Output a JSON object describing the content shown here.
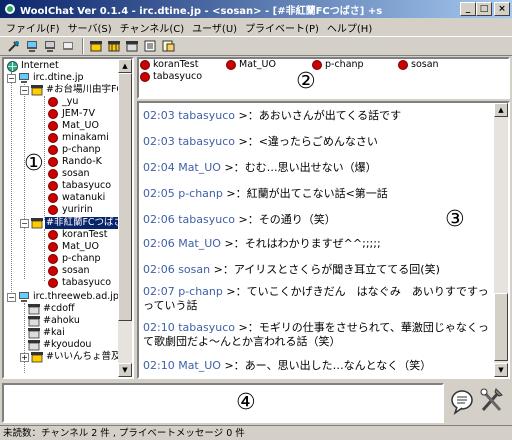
{
  "window": {
    "title": "WoolChat Ver 0.1.4 - irc.dtine.jp - <sosan> - [#非紅蘭FCつばさ] +s",
    "minimize": "_",
    "maximize": "□",
    "close": "×"
  },
  "menu": [
    "ファイル(F)",
    "サーバ(S)",
    "チャンネル(C)",
    "ユーザ(U)",
    "プライベート(P)",
    "ヘルプ(H)"
  ],
  "tree": {
    "root": "Internet",
    "servers": [
      {
        "name": "irc.dtine.jp",
        "channels": [
          {
            "name": "#お台場川由宇FC",
            "users": [
              "_yu",
              "JEM-7V",
              "Mat_UO",
              "minakami",
              "p-chanp",
              "Rando-K",
              "sosan",
              "tabasyuco",
              "watanuki",
              "yuririn"
            ]
          },
          {
            "name": "#非紅蘭FCつばさ",
            "users": [
              "koranTest",
              "Mat_UO",
              "p-chanp",
              "sosan",
              "tabasyuco"
            ]
          }
        ]
      },
      {
        "name": "irc.threeweb.ad.jp",
        "channels": [
          {
            "name": "#cdoff"
          },
          {
            "name": "#ahoku"
          },
          {
            "name": "#kai"
          },
          {
            "name": "#kyoudou"
          },
          {
            "name": "#いいんちょ普及委"
          }
        ]
      }
    ]
  },
  "members": [
    "koranTest",
    "Mat_UO",
    "p-chanp",
    "sosan",
    "tabasyuco"
  ],
  "chat": [
    {
      "time": "02:03",
      "nick": "tabasyuco",
      "text": "あおいさんが出てくる話です"
    },
    {
      "time": "02:03",
      "nick": "tabasyuco",
      "text": "<違ったらごめんなさい"
    },
    {
      "time": "02:04",
      "nick": "Mat_UO",
      "text": "むむ…思い出せない（爆）"
    },
    {
      "time": "02:05",
      "nick": "p-chanp",
      "text": "紅蘭が出てこない話<第一話"
    },
    {
      "time": "02:06",
      "nick": "tabasyuco",
      "text": "その通り（笑）"
    },
    {
      "time": "02:06",
      "nick": "Mat_UO",
      "text": "それはわかりますぜ^^;;;;;"
    },
    {
      "time": "02:06",
      "nick": "sosan",
      "text": "アイリスとさくらが聞き耳立ててる回(笑)"
    },
    {
      "time": "02:07",
      "nick": "p-chanp",
      "text": "ていこくかげきだん　はなぐみ　あいりすですっ　っていう話"
    },
    {
      "time": "02:10",
      "nick": "tabasyuco",
      "text": "モギリの仕事をさせられて、華激団じゃなくって歌劇団だよ〜んとか言われる話（笑）"
    },
    {
      "time": "02:10",
      "nick": "Mat_UO",
      "text": "あー、思い出した…なんとなく（笑）"
    }
  ],
  "input": {
    "value": ""
  },
  "status": "未読数：チャンネル 2 件 , プライベートメッセージ 0 件",
  "annotations": [
    "①",
    "②",
    "③",
    "④"
  ]
}
